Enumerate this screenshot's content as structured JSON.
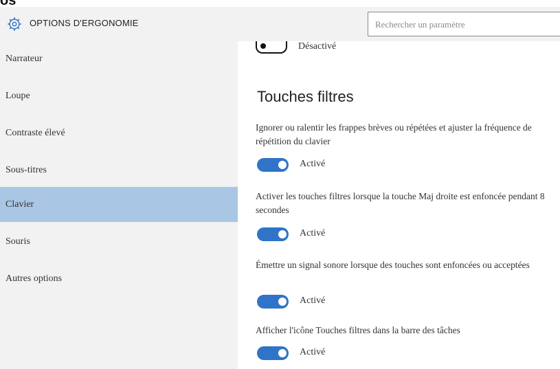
{
  "top_clipped_text": "os ”",
  "header": {
    "title": "OPTIONS D'ERGONOMIE",
    "gear_icon": "gear-icon",
    "search": {
      "placeholder": "Rechercher un paramètre"
    }
  },
  "sidebar": {
    "items": [
      {
        "label": "Narrateur",
        "selected": false
      },
      {
        "label": "Loupe",
        "selected": false
      },
      {
        "label": "Contraste élevé",
        "selected": false
      },
      {
        "label": "Sous-titres",
        "selected": false
      },
      {
        "label": "Clavier",
        "selected": true
      },
      {
        "label": "Souris",
        "selected": false
      },
      {
        "label": "Autres options",
        "selected": false
      }
    ]
  },
  "content": {
    "top_toggle": {
      "state_label": "Désactivé",
      "on": false
    },
    "section_title": "Touches filtres",
    "settings": [
      {
        "description": "Ignorer ou ralentir les frappes brèves ou répétées et ajuster la fréquence de répétition du clavier",
        "state_label": "Activé",
        "on": true
      },
      {
        "description": "Activer les touches filtres lorsque la touche Maj droite est enfoncée pendant 8 secondes",
        "state_label": "Activé",
        "on": true
      },
      {
        "description": "Émettre un signal sonore lorsque des touches sont enfoncées ou acceptées",
        "state_label": "Activé",
        "on": true
      },
      {
        "description": "Afficher l'icône Touches filtres dans la barre des tâches",
        "state_label": "Activé",
        "on": true
      }
    ]
  },
  "colors": {
    "accent": "#2f74c7",
    "selected_bg": "#a9c6e4",
    "sidebar_bg": "#f2f2f2"
  }
}
